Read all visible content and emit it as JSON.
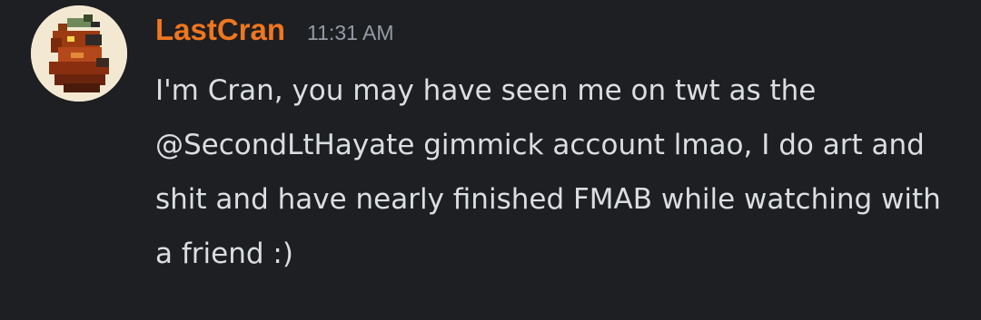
{
  "message": {
    "username": "LastCran",
    "timestamp": "11:31 AM",
    "content": "I'm Cran, you may have seen me on twt as the @SecondLtHayate gimmick account lmao, I do art and shit and have nearly finished FMAB while watching with a friend :)",
    "avatar_icon": "user-avatar-icon",
    "colors": {
      "username": "#f0761f",
      "timestamp": "#949ba4",
      "text": "#dbdee1",
      "background": "#1e1f22"
    }
  }
}
